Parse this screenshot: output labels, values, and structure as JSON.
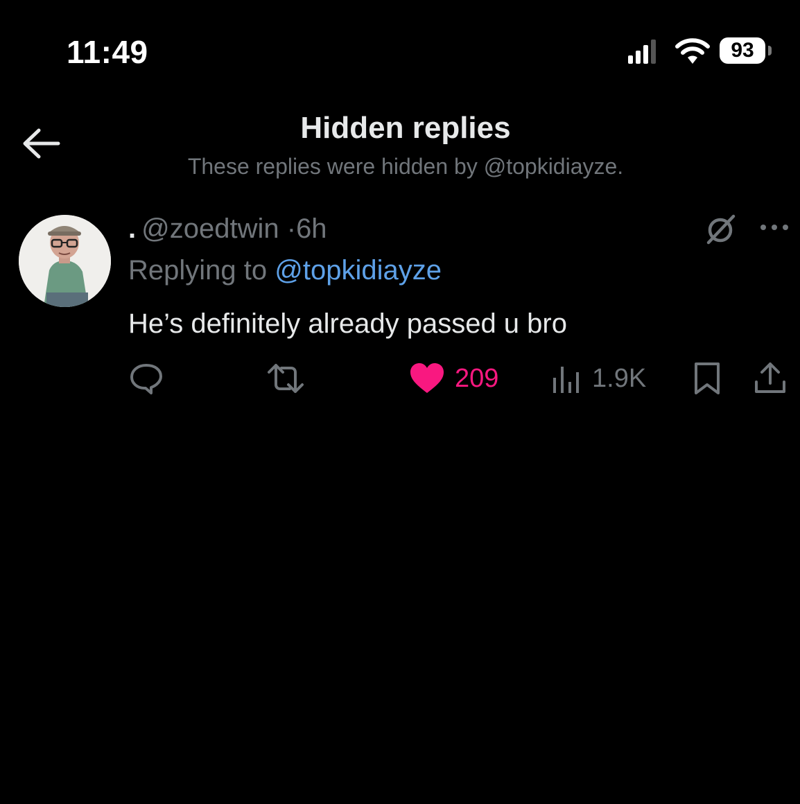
{
  "status_bar": {
    "time": "11:49",
    "battery": "93"
  },
  "header": {
    "title": "Hidden replies",
    "subtitle": "These replies were hidden by @topkidiayze."
  },
  "tweet": {
    "display_name": ".",
    "handle": "@zoedtwin",
    "separator": "·",
    "time": "6h",
    "replying_prefix": "Replying to",
    "replying_to": "@topkidiayze",
    "text": "He’s definitely already passed u bro",
    "likes": "209",
    "views": "1.9K"
  },
  "colors": {
    "background": "#000000",
    "text_primary": "#e7e9ea",
    "text_secondary": "#71767b",
    "mention": "#5ea1e8",
    "like": "#f91880"
  },
  "icons": [
    "back-arrow-icon",
    "signal-icon",
    "wifi-icon",
    "battery-icon",
    "hidden-reply-icon",
    "more-icon",
    "reply-icon",
    "retweet-icon",
    "heart-icon",
    "views-icon",
    "bookmark-icon",
    "share-icon"
  ]
}
